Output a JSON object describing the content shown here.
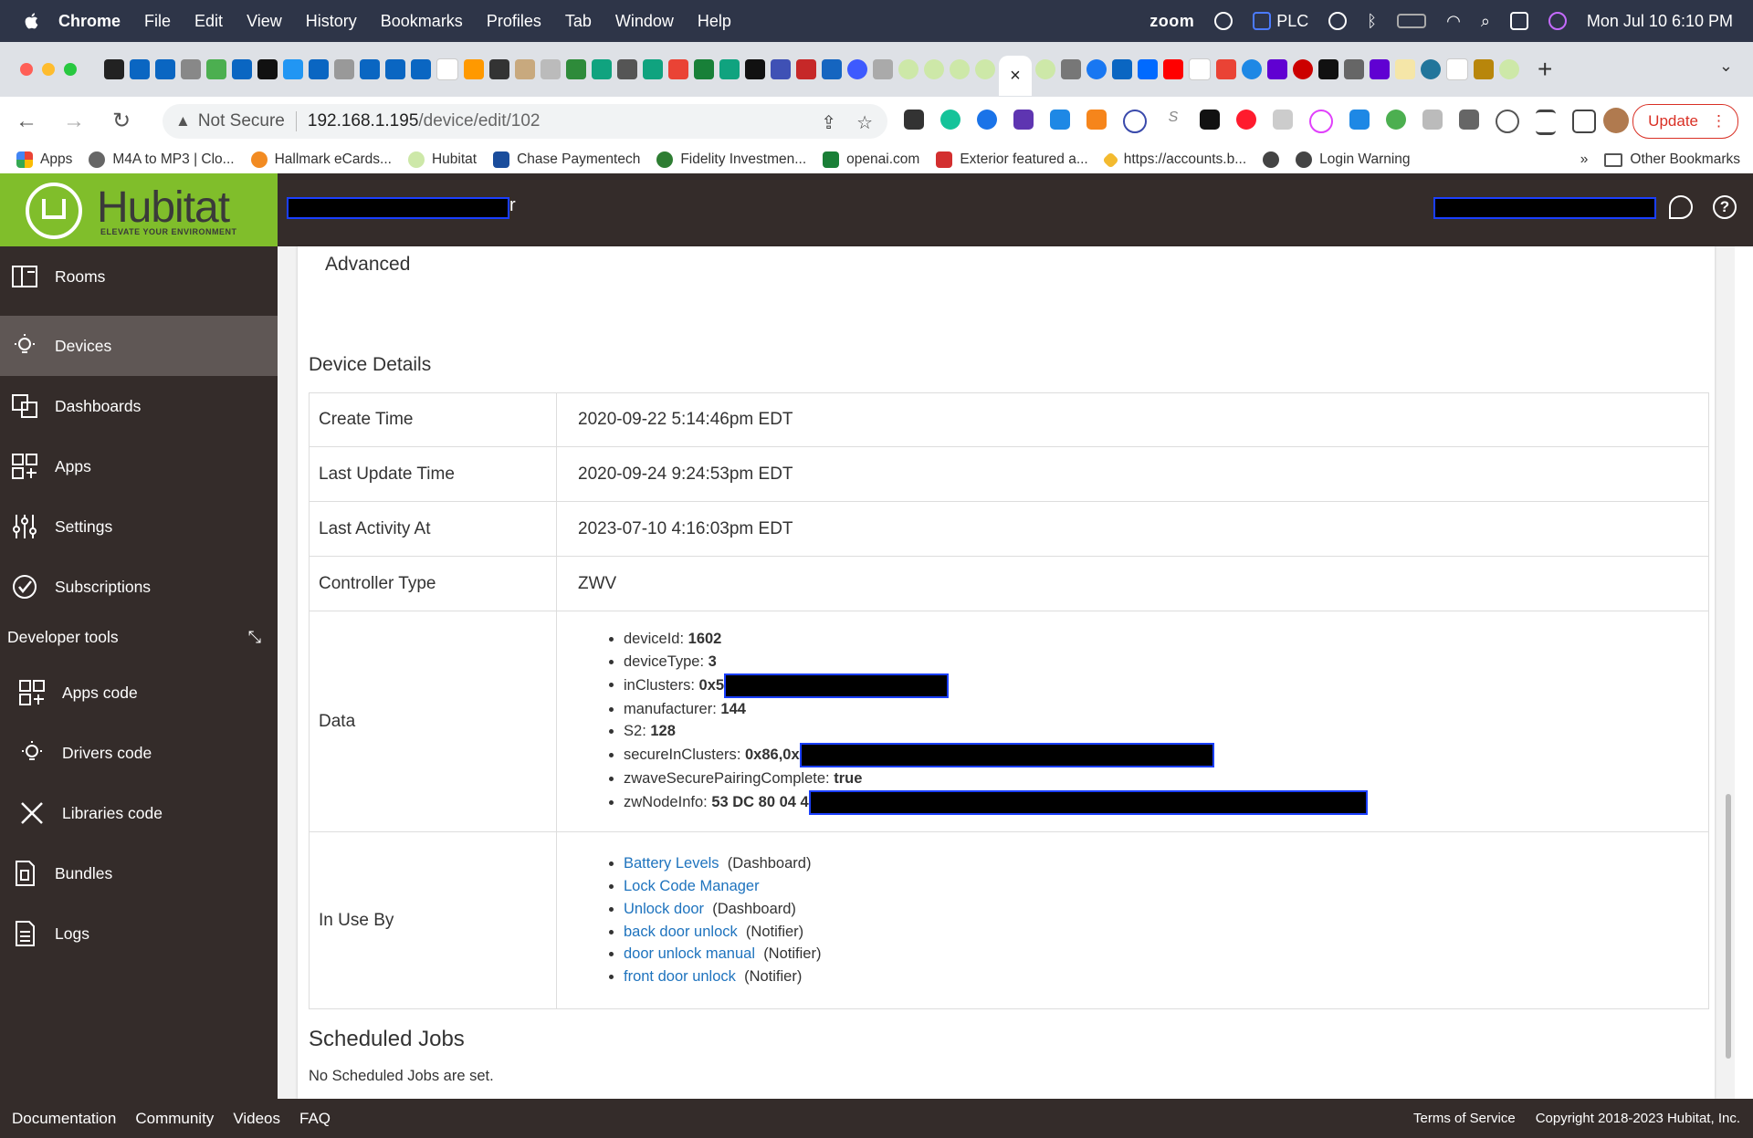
{
  "menubar": {
    "app": "Chrome",
    "items": [
      "File",
      "Edit",
      "View",
      "History",
      "Bookmarks",
      "Profiles",
      "Tab",
      "Window",
      "Help"
    ],
    "right": {
      "zoom": "zoom",
      "plc": "PLC",
      "datetime": "Mon Jul 10  6:10 PM"
    }
  },
  "tabs": {
    "close_glyph": "×",
    "new_tab": "+",
    "menu": "⌄"
  },
  "toolbar": {
    "back": "←",
    "forward": "→",
    "reload": "↻",
    "home": "⌂",
    "security": "Not Secure",
    "url_host": "192.168.1.195",
    "url_path": "/device/edit/102",
    "update_label": "Update"
  },
  "bookmarks": {
    "items": [
      {
        "label": "Apps",
        "color": "#e8453c"
      },
      {
        "label": "M4A to MP3 | Clo...",
        "color": "#666666"
      },
      {
        "label": "Hallmark eCards...",
        "color": "#f28b22"
      },
      {
        "label": "Hubitat",
        "color": "#80be2b"
      },
      {
        "label": "Chase Paymentech",
        "color": "#1a4d9c"
      },
      {
        "label": "Fidelity Investmen...",
        "color": "#2e7d32"
      },
      {
        "label": "openai.com",
        "color": "#1a7f37"
      },
      {
        "label": "Exterior featured a...",
        "color": "#d32f2f"
      },
      {
        "label": "https://accounts.b...",
        "color": "#f3ba2f"
      },
      {
        "label": "",
        "color": "#444444"
      },
      {
        "label": "Login Warning",
        "color": "#444444"
      }
    ],
    "more": "»",
    "other": "Other Bookmarks"
  },
  "header": {
    "title_suffix": "r",
    "logo_word": "Hubitat",
    "logo_tag": "ELEVATE YOUR ENVIRONMENT",
    "brand_color": "#80be2b",
    "help_glyph": "?"
  },
  "sidebar": {
    "items": [
      {
        "label": "Rooms"
      },
      {
        "label": "Devices"
      },
      {
        "label": "Dashboards"
      },
      {
        "label": "Apps"
      },
      {
        "label": "Settings"
      },
      {
        "label": "Subscriptions"
      }
    ],
    "devtools_label": "Developer tools",
    "devtools_items": [
      {
        "label": "Apps code"
      },
      {
        "label": "Drivers code"
      },
      {
        "label": "Libraries code"
      }
    ],
    "bottom_items": [
      {
        "label": "Bundles"
      },
      {
        "label": "Logs"
      }
    ]
  },
  "main": {
    "advanced_label": "Advanced",
    "device_details_title": "Device Details",
    "rows": [
      {
        "key": "Create Time",
        "value": "2020-09-22 5:14:46pm EDT"
      },
      {
        "key": "Last Update Time",
        "value": "2020-09-24 9:24:53pm EDT"
      },
      {
        "key": "Last Activity At",
        "value": "2023-07-10 4:16:03pm EDT"
      },
      {
        "key": "Controller Type",
        "value": "ZWV"
      }
    ],
    "data_key": "Data",
    "data_items": [
      {
        "name": "deviceId",
        "value": "1602"
      },
      {
        "name": "deviceType",
        "value": "3"
      },
      {
        "name": "inClusters",
        "value": "0x5"
      },
      {
        "name": "manufacturer",
        "value": "144"
      },
      {
        "name": "S2",
        "value": "128"
      },
      {
        "name": "secureInClusters",
        "value": "0x86,0x"
      },
      {
        "name": "zwaveSecurePairingComplete",
        "value": "true"
      },
      {
        "name": "zwNodeInfo",
        "value": "53 DC 80 04 4"
      }
    ],
    "in_use_key": "In Use By",
    "in_use_items": [
      {
        "link": "Battery Levels",
        "type": "(Dashboard)"
      },
      {
        "link": "Lock Code Manager",
        "type": ""
      },
      {
        "link": "Unlock door",
        "type": "(Dashboard)"
      },
      {
        "link": "back door unlock",
        "type": "(Notifier)"
      },
      {
        "link": "door unlock manual",
        "type": "(Notifier)"
      },
      {
        "link": "front door unlock",
        "type": "(Notifier)"
      }
    ],
    "scheduled_title": "Scheduled Jobs",
    "no_jobs": "No Scheduled Jobs are set."
  },
  "footer": {
    "links": [
      "Documentation",
      "Community",
      "Videos",
      "FAQ"
    ],
    "terms": "Terms of Service",
    "copyright": "Copyright 2018-2023 Hubitat, Inc."
  }
}
